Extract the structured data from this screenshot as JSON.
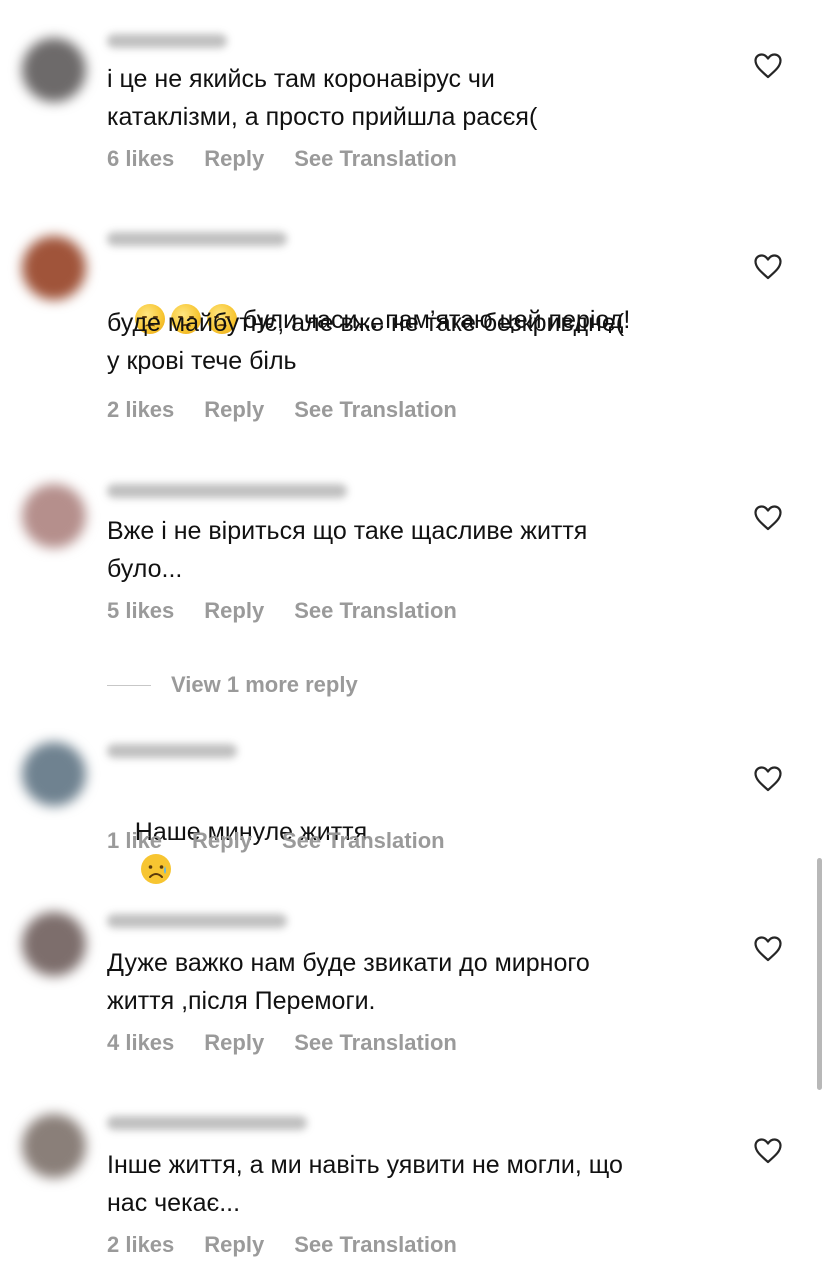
{
  "comments": [
    {
      "text": "і це не якийсь там коронавірус чи\nкатаклізми, а просто прийшла расєя(",
      "likes": "6 likes",
      "reply": "Reply",
      "translate": "See Translation",
      "avatar_color": "#6d6a6a"
    },
    {
      "text_prefix": "були часи....пам’ятаю цей період!",
      "text": "буде майбутнє, але вже не таке безкривдне(\nу крові тече біль",
      "emoji_count": 3,
      "emoji_icon": "pensive-face-icon",
      "likes": "2 likes",
      "reply": "Reply",
      "translate": "See Translation",
      "avatar_color": "#a0543a"
    },
    {
      "text": "Вже і не віриться що таке щасливе життя\nбуло...",
      "likes": "5 likes",
      "reply": "Reply",
      "translate": "See Translation",
      "avatar_color": "#b58f8c"
    },
    {
      "text": "Наше минуле життя",
      "emoji_icon": "sad-but-relieved-face-icon",
      "likes": "1 like",
      "reply": "Reply",
      "translate": "See Translation",
      "avatar_color": "#6f8290"
    },
    {
      "text": "Дуже важко нам буде звикати до мирного\nжиття ,після Перемоги.",
      "likes": "4 likes",
      "reply": "Reply",
      "translate": "See Translation",
      "avatar_color": "#7d6e6c"
    },
    {
      "text": "Інше життя, а ми навіть уявити не могли, що\nнас чекає...",
      "likes": "2 likes",
      "reply": "Reply",
      "translate": "See Translation",
      "avatar_color": "#8a7f79"
    }
  ],
  "view_more": {
    "label": "View 1 more reply"
  },
  "icons": {
    "like": "heart-icon"
  },
  "colors": {
    "text": "#111111",
    "meta": "#9a9a9a",
    "heart_stroke": "#262626"
  }
}
